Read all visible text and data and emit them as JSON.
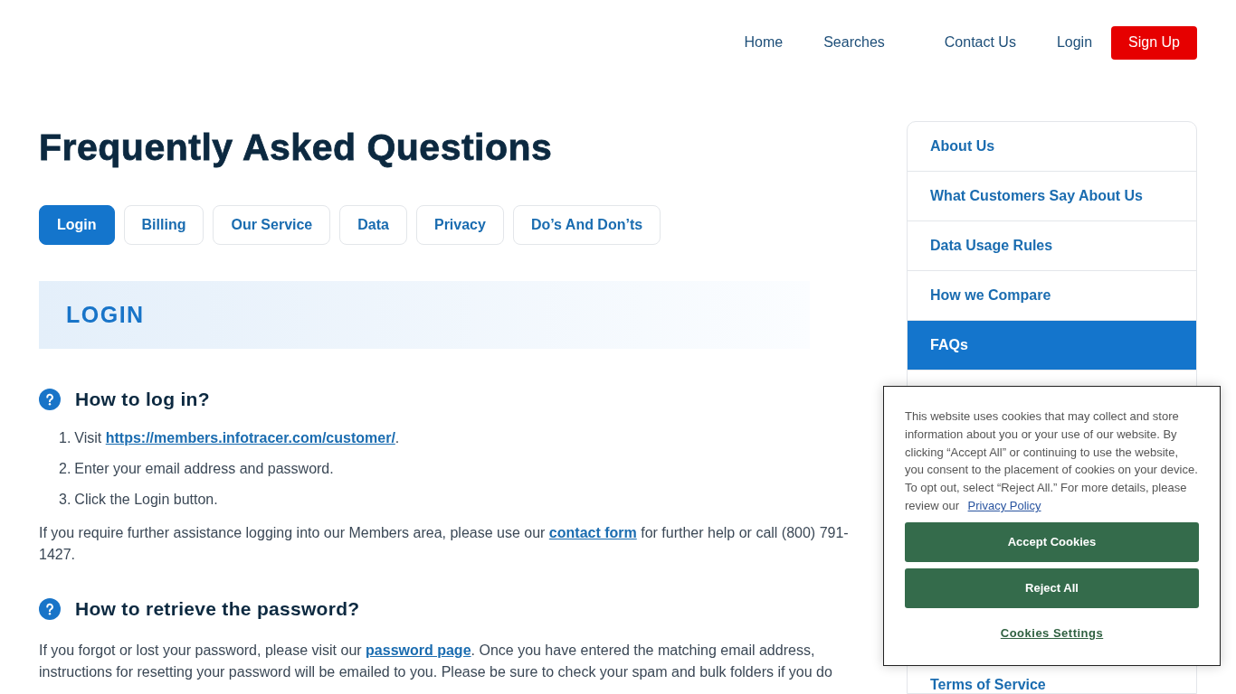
{
  "nav": {
    "links": [
      {
        "label": "Home",
        "kind": "link"
      },
      {
        "label": "Searches",
        "kind": "link"
      },
      {
        "label": "Contact Us",
        "kind": "link"
      },
      {
        "label": "Login",
        "kind": "link"
      },
      {
        "label": "Sign Up",
        "kind": "button"
      }
    ]
  },
  "title": "Frequently Asked Questions",
  "tabs": [
    {
      "label": "Login",
      "selected": true
    },
    {
      "label": "Billing",
      "selected": false
    },
    {
      "label": "Our Service",
      "selected": false
    },
    {
      "label": "Data",
      "selected": false
    },
    {
      "label": "Privacy",
      "selected": false
    },
    {
      "label": "Do’s And Don’ts",
      "selected": false
    }
  ],
  "section_banner": "LOGIN",
  "questions": [
    {
      "title": "How to log in?",
      "steps": [
        {
          "number": "1.",
          "text": "Visit ",
          "link": "https://members.infotracer.com/customer/",
          "after": "."
        },
        {
          "number": "2.",
          "text": "Enter your email address and password."
        },
        {
          "number": "3.",
          "text": "Click the Login button."
        }
      ],
      "paragraph": {
        "before": "If you require further assistance logging into our Members area, please use our ",
        "link": "contact form",
        "after": " for further help or call (800) 791-1427."
      }
    },
    {
      "title": "How to retrieve the password?",
      "paragraph": {
        "before": "If you forgot or lost your password, please visit our ",
        "link": "password page",
        "after": ". Once you have entered the matching email address, instructions for resetting your password will be emailed to you. Please be sure to check your spam and bulk folders if you do"
      }
    }
  ],
  "sidebar": {
    "items": [
      {
        "label": "About Us",
        "selected": false
      },
      {
        "label": "What Customers Say About Us",
        "selected": false
      },
      {
        "label": "Data Usage Rules",
        "selected": false
      },
      {
        "label": "How we Compare",
        "selected": false
      },
      {
        "label": "FAQs",
        "selected": true
      }
    ],
    "bottom_item": "Terms of Service"
  },
  "cookie_banner": {
    "text": "This website uses cookies that may collect and store information about you or your use of our website. By clicking “Accept All” or continuing to use the website, you consent to the placement of cookies on your device. To opt out, select “Reject All.” For more details, please review our ",
    "link": "Privacy Policy",
    "buttons": [
      "Accept Cookies",
      "Reject All"
    ],
    "settings_link": "Cookies Settings"
  }
}
